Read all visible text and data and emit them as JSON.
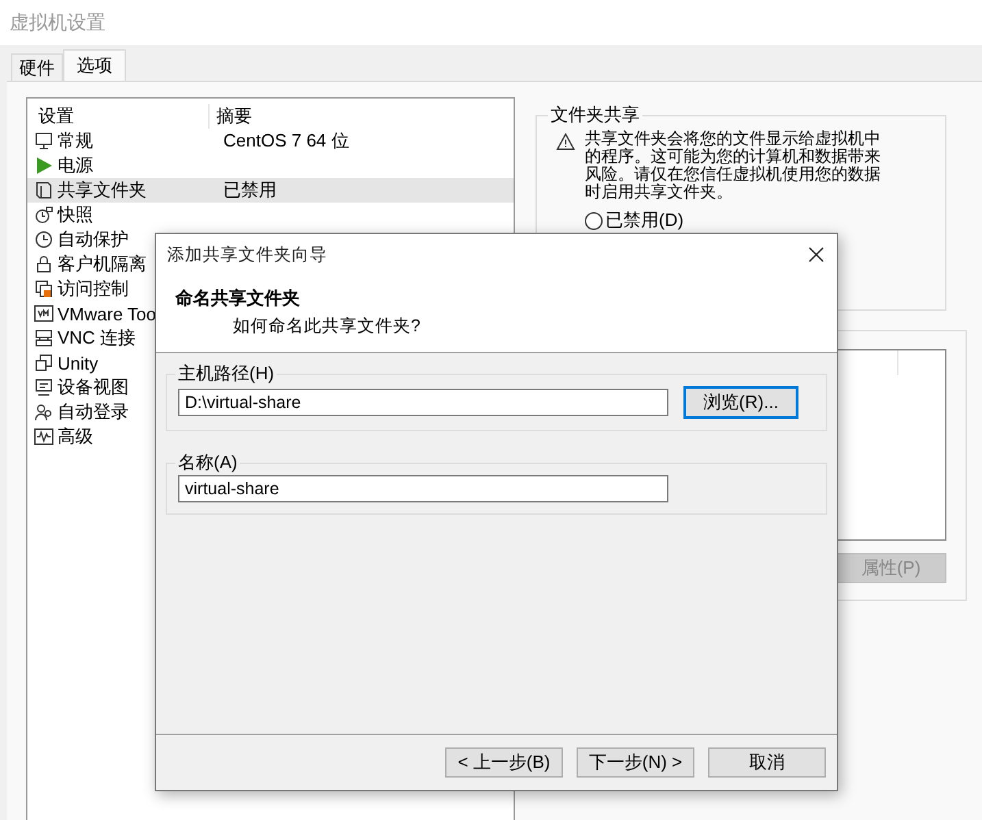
{
  "window": {
    "title": "虚拟机设置"
  },
  "tabs": [
    {
      "label": "硬件",
      "selected": false
    },
    {
      "label": "选项",
      "selected": true
    }
  ],
  "settings_list": {
    "columns": [
      "设置",
      "摘要"
    ],
    "rows": [
      {
        "name": "常规",
        "summary": "CentOS 7 64 位",
        "selected": false
      },
      {
        "name": "电源",
        "selected": false
      },
      {
        "name": "共享文件夹",
        "summary": "已禁用",
        "selected": true
      },
      {
        "name": "快照",
        "selected": false
      },
      {
        "name": "自动保护",
        "selected": false
      },
      {
        "name": "客户机隔离",
        "selected": false
      },
      {
        "name": "访问控制",
        "selected": false
      },
      {
        "name": "VMware Too",
        "selected": false
      },
      {
        "name": "VNC 连接",
        "selected": false
      },
      {
        "name": "Unity",
        "selected": false
      },
      {
        "name": "设备视图",
        "selected": false
      },
      {
        "name": "自动登录",
        "selected": false
      },
      {
        "name": "高级",
        "selected": false
      }
    ]
  },
  "folder_sharing": {
    "title": "文件夹共享",
    "warning": "共享文件夹会将您的文件显示给虚拟机中的程序。这可能为您的计算机和数据带来风险。请仅在您信任虚拟机使用您的数据时启用共享文件夹。",
    "options": [
      {
        "label": "已禁用(D)",
        "selected": false
      }
    ]
  },
  "shared_folders": {
    "button": {
      "label": "属性(P)",
      "disabled": true
    }
  },
  "dialog": {
    "title": "添加共享文件夹向导",
    "heading": "命名共享文件夹",
    "subheading": "如何命名此共享文件夹?",
    "fields": [
      {
        "label": "主机路径(H)",
        "value": "D:\\virtual-share",
        "button": {
          "label": "浏览(R)...",
          "focused": true
        }
      },
      {
        "label": "名称(A)",
        "value": "virtual-share"
      }
    ],
    "buttons": [
      {
        "label": "< 上一步(B)",
        "disabled": false
      },
      {
        "label": "下一步(N) >",
        "disabled": false
      },
      {
        "label": "取消",
        "disabled": false
      }
    ]
  }
}
